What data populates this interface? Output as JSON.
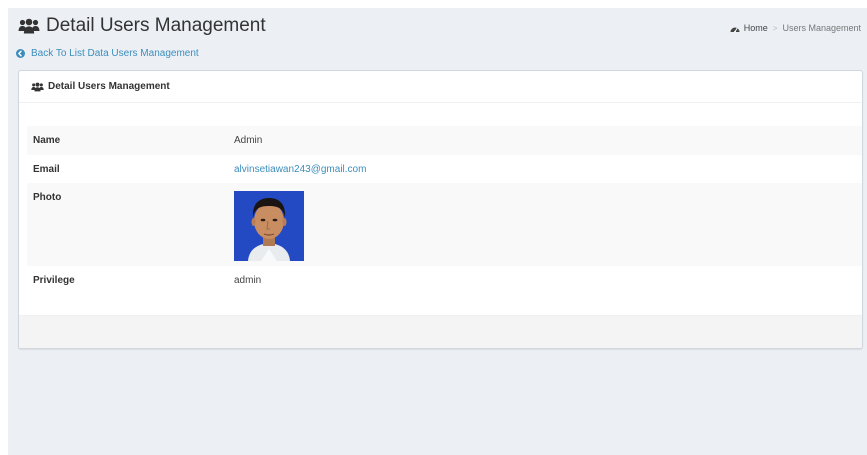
{
  "header": {
    "title": "Detail Users Management",
    "title_icon": "users-icon"
  },
  "breadcrumb": {
    "home_icon": "dashboard-icon",
    "home_label": "Home",
    "separator": ">",
    "current": "Users Management"
  },
  "back_link": {
    "icon": "arrow-circle-left-icon",
    "label": "Back To List Data Users Management"
  },
  "panel": {
    "title": "Detail Users Management",
    "title_icon": "users-icon"
  },
  "details": {
    "name_label": "Name",
    "name_value": "Admin",
    "email_label": "Email",
    "email_value": "alvinsetiawan243@gmail.com",
    "photo_label": "Photo",
    "privilege_label": "Privilege",
    "privilege_value": "admin"
  },
  "colors": {
    "background": "#ecf0f5",
    "link": "#3c8dbc",
    "striped_row": "#f9f9f9",
    "photo_backdrop": "#1f43b8"
  }
}
